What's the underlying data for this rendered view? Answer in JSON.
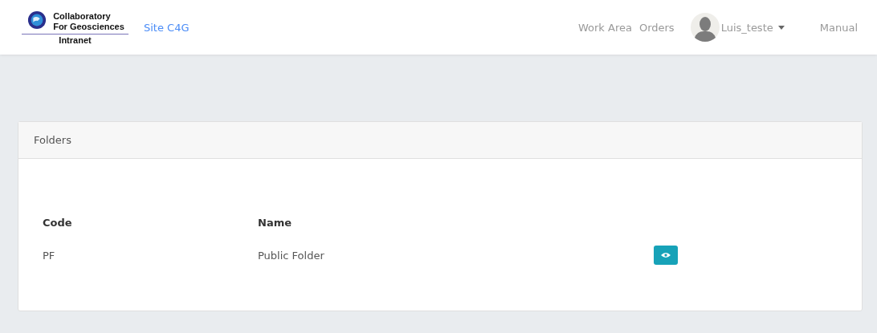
{
  "navbar": {
    "logo": {
      "lines": [
        "Collaboratory",
        "For Geosciences"
      ],
      "subtitle": "Intranet"
    },
    "site_link": "Site C4G",
    "links": [
      "Work Area",
      "Orders"
    ],
    "user": {
      "name": "Luis_teste"
    },
    "manual": "Manual"
  },
  "card": {
    "title": "Folders",
    "table": {
      "columns": [
        "Code",
        "Name"
      ],
      "rows": [
        {
          "code": "PF",
          "name": "Public Folder"
        }
      ]
    }
  }
}
